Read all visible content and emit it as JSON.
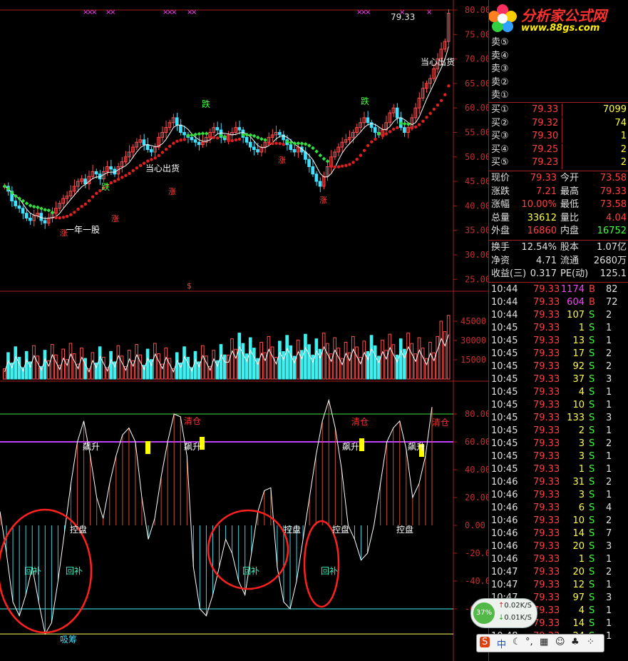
{
  "price_axis": [
    "80.00",
    "75.00",
    "70.00",
    "65.00",
    "60.00",
    "55.00",
    "50.00",
    "45.00",
    "40.00",
    "35.00",
    "30.00",
    "25.00"
  ],
  "volume_axis": [
    "45000",
    "30000",
    "15000"
  ],
  "indicator_axis": [
    "80.00",
    "60.00",
    "40.00",
    "20.00",
    "0.00",
    "-20.00",
    "-40.00",
    "-6"
  ],
  "annotations": {
    "last_price": "79.33",
    "ship_out": "当心出货",
    "ship_out_2": "当心出货",
    "one_year": "一年一股",
    "fall_1": "跌",
    "fall_2": "跌",
    "fall_3": "跌",
    "rise_1": "涨",
    "rise_2": "涨",
    "rise_3": "涨",
    "rise_4": "涨",
    "rise_5": "涨",
    "dollar": "$",
    "clear_1": "清仓",
    "clear_2": "清仓",
    "clear_3": "清仓",
    "surge_1": "飙升",
    "surge_2": "飙升",
    "surge_3": "飙升",
    "surge_4": "飙升",
    "control_1": "控盘",
    "control_2": "控盘",
    "control_3": "控盘",
    "control_4": "控盘",
    "rebound_1": "回补",
    "rebound_2": "回补",
    "rebound_3": "回补",
    "rebound_4": "回补",
    "absorb": "吸筹"
  },
  "logo": {
    "name": "分析家公式网",
    "url": "www.88gs.com"
  },
  "sell_orders": [
    {
      "label": "卖⑤",
      "price": "",
      "vol": ""
    },
    {
      "label": "卖④",
      "price": "",
      "vol": ""
    },
    {
      "label": "卖③",
      "price": "",
      "vol": ""
    },
    {
      "label": "卖②",
      "price": "",
      "vol": ""
    },
    {
      "label": "卖①",
      "price": "",
      "vol": ""
    }
  ],
  "buy_orders": [
    {
      "label": "买①",
      "price": "79.33",
      "vol": "7099"
    },
    {
      "label": "买②",
      "price": "79.32",
      "vol": "74"
    },
    {
      "label": "买③",
      "price": "79.30",
      "vol": "1"
    },
    {
      "label": "买④",
      "price": "79.25",
      "vol": "2"
    },
    {
      "label": "买⑤",
      "price": "79.23",
      "vol": "2"
    }
  ],
  "stats": [
    {
      "l1": "现价",
      "v1": "79.33",
      "l2": "今开",
      "v2": "73.58"
    },
    {
      "l1": "涨跌",
      "v1": "7.21",
      "l2": "最高",
      "v2": "79.33"
    },
    {
      "l1": "涨幅",
      "v1": "10.00%",
      "l2": "最低",
      "v2": "73.58"
    },
    {
      "l1": "总量",
      "v1": "33612",
      "l2": "量比",
      "v2": "4.04"
    },
    {
      "l1": "外盘",
      "v1": "16860",
      "l2": "内盘",
      "v2": "16752"
    }
  ],
  "stats2": [
    {
      "l1": "换手",
      "v1": "12.54%",
      "l2": "股本",
      "v2": "1.07亿"
    },
    {
      "l1": "净资",
      "v1": "4.71",
      "l2": "流通",
      "v2": "2680万"
    },
    {
      "l1": "收益(三)",
      "v1": "0.317",
      "l2": "PE(动)",
      "v2": "125.1"
    }
  ],
  "ticks": [
    {
      "t": "10:44",
      "p": "79.33",
      "v": "1174",
      "d": "B",
      "n": "82"
    },
    {
      "t": "10:44",
      "p": "79.33",
      "v": "604",
      "d": "B",
      "n": "72"
    },
    {
      "t": "10:44",
      "p": "79.33",
      "v": "107",
      "d": "S",
      "n": "2"
    },
    {
      "t": "10:45",
      "p": "79.33",
      "v": "1",
      "d": "S",
      "n": "1"
    },
    {
      "t": "10:45",
      "p": "79.33",
      "v": "13",
      "d": "S",
      "n": "1"
    },
    {
      "t": "10:45",
      "p": "79.33",
      "v": "17",
      "d": "S",
      "n": "2"
    },
    {
      "t": "10:45",
      "p": "79.33",
      "v": "92",
      "d": "S",
      "n": "2"
    },
    {
      "t": "10:45",
      "p": "79.33",
      "v": "37",
      "d": "S",
      "n": "3"
    },
    {
      "t": "10:45",
      "p": "79.33",
      "v": "4",
      "d": "S",
      "n": "1"
    },
    {
      "t": "10:45",
      "p": "79.33",
      "v": "10",
      "d": "S",
      "n": "1"
    },
    {
      "t": "10:45",
      "p": "79.33",
      "v": "133",
      "d": "S",
      "n": "3"
    },
    {
      "t": "10:45",
      "p": "79.33",
      "v": "2",
      "d": "S",
      "n": "1"
    },
    {
      "t": "10:45",
      "p": "79.33",
      "v": "3",
      "d": "S",
      "n": "2"
    },
    {
      "t": "10:45",
      "p": "79.33",
      "v": "3",
      "d": "S",
      "n": "1"
    },
    {
      "t": "10:45",
      "p": "79.33",
      "v": "1",
      "d": "S",
      "n": "1"
    },
    {
      "t": "10:46",
      "p": "79.33",
      "v": "31",
      "d": "S",
      "n": "2"
    },
    {
      "t": "10:46",
      "p": "79.33",
      "v": "3",
      "d": "S",
      "n": "1"
    },
    {
      "t": "10:46",
      "p": "79.33",
      "v": "6",
      "d": "S",
      "n": "4"
    },
    {
      "t": "10:46",
      "p": "79.33",
      "v": "10",
      "d": "S",
      "n": "2"
    },
    {
      "t": "10:46",
      "p": "79.33",
      "v": "14",
      "d": "S",
      "n": "7"
    },
    {
      "t": "10:46",
      "p": "79.33",
      "v": "20",
      "d": "S",
      "n": "3"
    },
    {
      "t": "10:46",
      "p": "79.33",
      "v": "1",
      "d": "S",
      "n": "1"
    },
    {
      "t": "10:47",
      "p": "79.33",
      "v": "20",
      "d": "S",
      "n": "2"
    },
    {
      "t": "10:47",
      "p": "79.33",
      "v": "12",
      "d": "S",
      "n": "1"
    },
    {
      "t": "10:47",
      "p": "79.33",
      "v": "97",
      "d": "S",
      "n": "3"
    },
    {
      "t": "10:47",
      "p": "79.33",
      "v": "4",
      "d": "S",
      "n": "1"
    },
    {
      "t": "10:47",
      "p": "79.33",
      "v": "14",
      "d": "S",
      "n": "1"
    },
    {
      "t": "10:48",
      "p": "79.33",
      "v": "24",
      "d": "S",
      "n": "1"
    }
  ],
  "speed": {
    "pct": "37%",
    "up": "0.02K/S",
    "down": "0.01K/S"
  },
  "ime": {
    "s": "S",
    "lang": "中"
  }
}
